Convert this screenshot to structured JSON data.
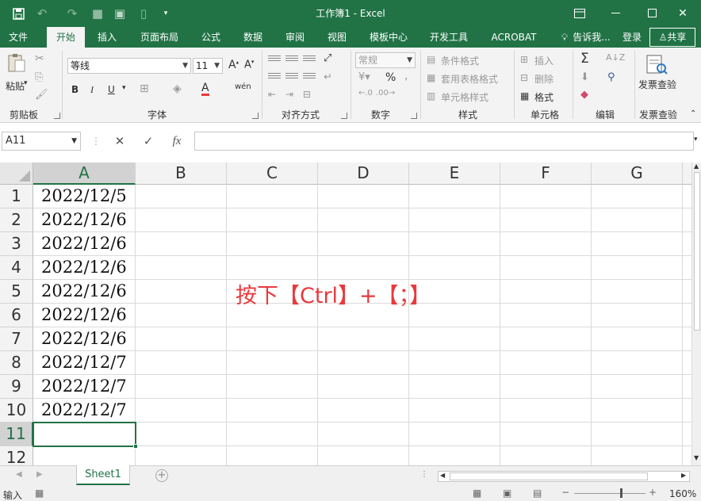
{
  "title_bar": {
    "title": "工作簿1 - Excel",
    "save_icon": "save-icon",
    "undo_icon": "undo-icon",
    "redo_icon": "redo-icon"
  },
  "ribbon_tabs": [
    "文件",
    "开始",
    "插入",
    "页面布局",
    "公式",
    "数据",
    "审阅",
    "视图",
    "模板中心",
    "开发工具",
    "ACROBAT"
  ],
  "tell_me": "告诉我...",
  "login": "登录",
  "share": "共享",
  "ribbon": {
    "clipboard": {
      "label": "剪贴板",
      "paste": "粘贴"
    },
    "font": {
      "label": "字体",
      "font_name": "等线",
      "font_size": "11",
      "bold": "B",
      "italic": "I",
      "underline": "U",
      "phonetic": "wén"
    },
    "alignment": {
      "label": "对齐方式"
    },
    "number": {
      "label": "数字",
      "format": "常规",
      "percent": "%",
      "comma": ","
    },
    "styles": {
      "label": "样式",
      "conditional": "条件格式",
      "table": "套用表格格式",
      "cell_styles": "单元格样式"
    },
    "cells": {
      "label": "单元格",
      "insert": "插入",
      "delete": "删除",
      "format": "格式"
    },
    "editing": {
      "label": "编辑"
    },
    "invoice": {
      "label": "发票查验",
      "button": "发票查验"
    }
  },
  "formula_bar": {
    "name_box": "A11",
    "fx": "fx",
    "value": ""
  },
  "columns": [
    "A",
    "B",
    "C",
    "D",
    "E",
    "F",
    "G"
  ],
  "rows": [
    "1",
    "2",
    "3",
    "4",
    "5",
    "6",
    "7",
    "8",
    "9",
    "10",
    "11",
    "12"
  ],
  "cells_a": [
    "2022/12/5",
    "2022/12/6",
    "2022/12/6",
    "2022/12/6",
    "2022/12/6",
    "2022/12/6",
    "2022/12/6",
    "2022/12/7",
    "2022/12/7",
    "2022/12/7",
    ""
  ],
  "annotation": "按下【Ctrl】+【；】",
  "sheet_tab": "Sheet1",
  "status": {
    "mode": "输入",
    "zoom": "160%"
  },
  "colors": {
    "accent": "#217346",
    "annotation": "#e8393d"
  }
}
